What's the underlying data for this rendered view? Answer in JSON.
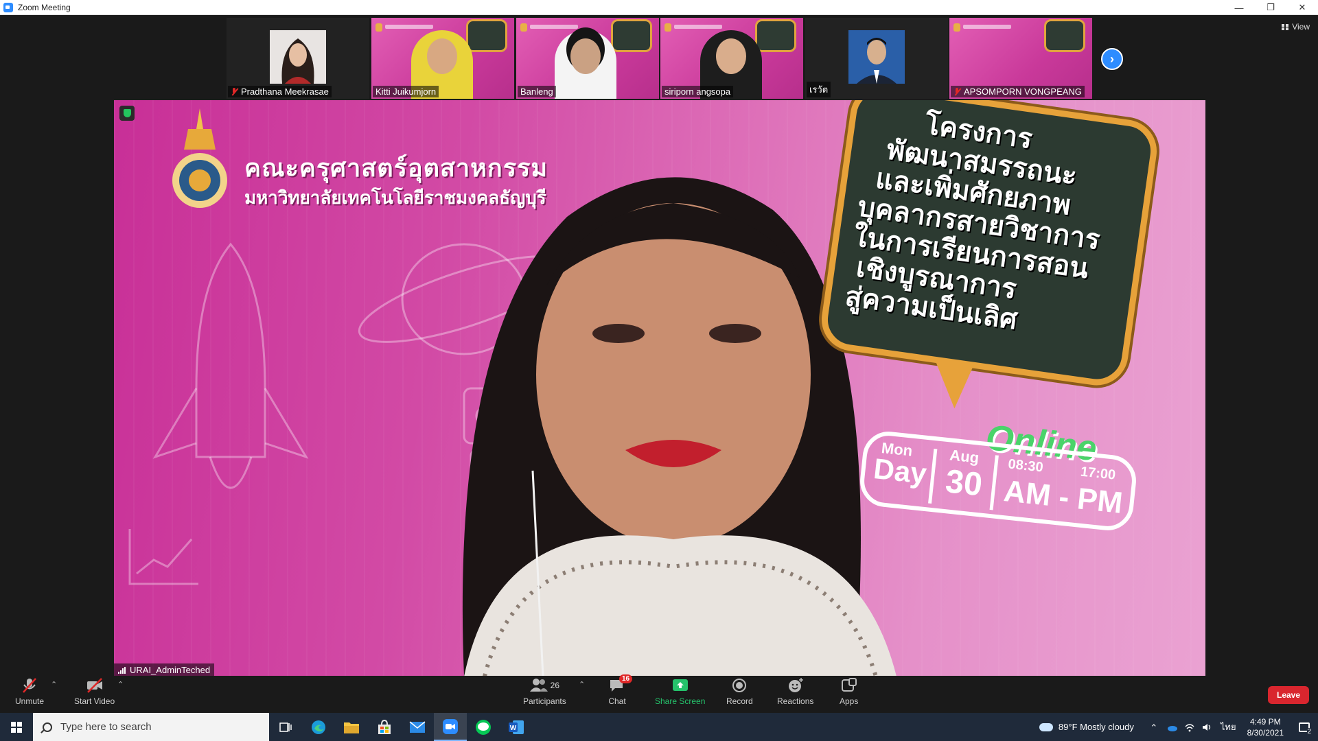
{
  "window": {
    "title": "Zoom Meeting"
  },
  "gallery": {
    "participants": [
      {
        "name": "Pradthana Meekrasae",
        "muted": true
      },
      {
        "name": "Kitti Juikumjorn",
        "muted": false
      },
      {
        "name": "Banleng",
        "muted": false
      },
      {
        "name": "siriporn angsopa",
        "muted": false
      },
      {
        "name": "เรวัต",
        "muted": false
      },
      {
        "name": "APSOMPORN VONGPEANG",
        "muted": true
      }
    ],
    "view_label": "View"
  },
  "main": {
    "speaker_name": "URAI_AdminTeched",
    "slide": {
      "faculty": "คณะครุศาสตร์อุตสาหกรรม",
      "university": "มหาวิทยาลัยเทคโนโลยีราชมงคลธัญบุรี",
      "board_lines": [
        "โครงการ",
        "พัฒนาสมรรถนะ",
        "และเพิ่มศักยภาพ",
        "บุคลากรสายวิชาการ",
        "ในการเรียนการสอน",
        "เชิงบูรณาการ",
        "สู่ความเป็นเลิศ"
      ],
      "online": "Online",
      "mon": "Mon",
      "day": "Day",
      "aug": "Aug",
      "date_num": "30",
      "time_start": "08:30",
      "time_end": "17:00",
      "ampm": "AM - PM"
    }
  },
  "toolbar": {
    "unmute": "Unmute",
    "start_video": "Start Video",
    "participants": "Participants",
    "participants_count": "26",
    "chat": "Chat",
    "chat_badge": "16",
    "share_screen": "Share Screen",
    "record": "Record",
    "reactions": "Reactions",
    "apps": "Apps",
    "leave": "Leave"
  },
  "taskbar": {
    "search_placeholder": "Type here to search",
    "weather": "89°F  Mostly cloudy",
    "lang": "ไทย",
    "time": "4:49 PM",
    "date": "8/30/2021",
    "notif_count": "2"
  },
  "colors": {
    "zoom_blue": "#2d8cff",
    "leave_red": "#d9262e",
    "share_green": "#25c26b",
    "slide_pink": "#c82f97"
  }
}
